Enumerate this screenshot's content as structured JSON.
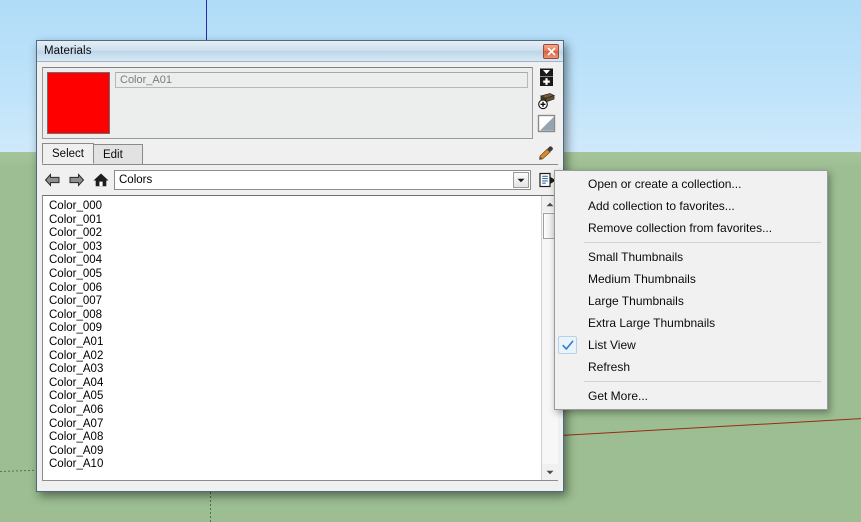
{
  "viewport": {
    "sky_color": "#b4ddf7",
    "ground_color": "#9cbe92",
    "blue_axis_color": "#2a2ab0",
    "red_axis_color": "#9c2a14"
  },
  "dialog": {
    "title": "Materials",
    "close_label": "x",
    "preview": {
      "swatch_color": "#fe0000",
      "material_name": "Color_A01",
      "name_placeholder": "Color_A01"
    },
    "tools": [
      {
        "name": "create-material-icon",
        "title": "Create Material"
      },
      {
        "name": "add-to-model-icon",
        "title": "Add collection"
      },
      {
        "name": "display-secondary-selection-icon",
        "title": "Display secondary selection"
      },
      {
        "name": "sample-paint-icon",
        "title": "Sample paint"
      }
    ],
    "tabs": [
      {
        "label": "Select",
        "active": true
      },
      {
        "label": "Edit",
        "active": false
      }
    ],
    "nav": {
      "back_icon": "back-arrow-icon",
      "forward_icon": "forward-arrow-icon",
      "home_icon": "home-icon",
      "collection": "Colors",
      "details_icon": "details-icon"
    },
    "list": [
      "Color_000",
      "Color_001",
      "Color_002",
      "Color_003",
      "Color_004",
      "Color_005",
      "Color_006",
      "Color_007",
      "Color_008",
      "Color_009",
      "Color_A01",
      "Color_A02",
      "Color_A03",
      "Color_A04",
      "Color_A05",
      "Color_A06",
      "Color_A07",
      "Color_A08",
      "Color_A09",
      "Color_A10"
    ]
  },
  "context_menu": {
    "groups": [
      [
        {
          "label": "Open or create a collection...",
          "checked": false
        },
        {
          "label": "Add collection to favorites...",
          "checked": false
        },
        {
          "label": "Remove collection from favorites...",
          "checked": false
        }
      ],
      [
        {
          "label": "Small Thumbnails",
          "checked": false
        },
        {
          "label": "Medium Thumbnails",
          "checked": false
        },
        {
          "label": "Large Thumbnails",
          "checked": false
        },
        {
          "label": "Extra Large Thumbnails",
          "checked": false
        },
        {
          "label": "List View",
          "checked": true
        },
        {
          "label": "Refresh",
          "checked": false
        }
      ],
      [
        {
          "label": "Get More...",
          "checked": false
        }
      ]
    ],
    "check_color": "#2f7bd0"
  }
}
